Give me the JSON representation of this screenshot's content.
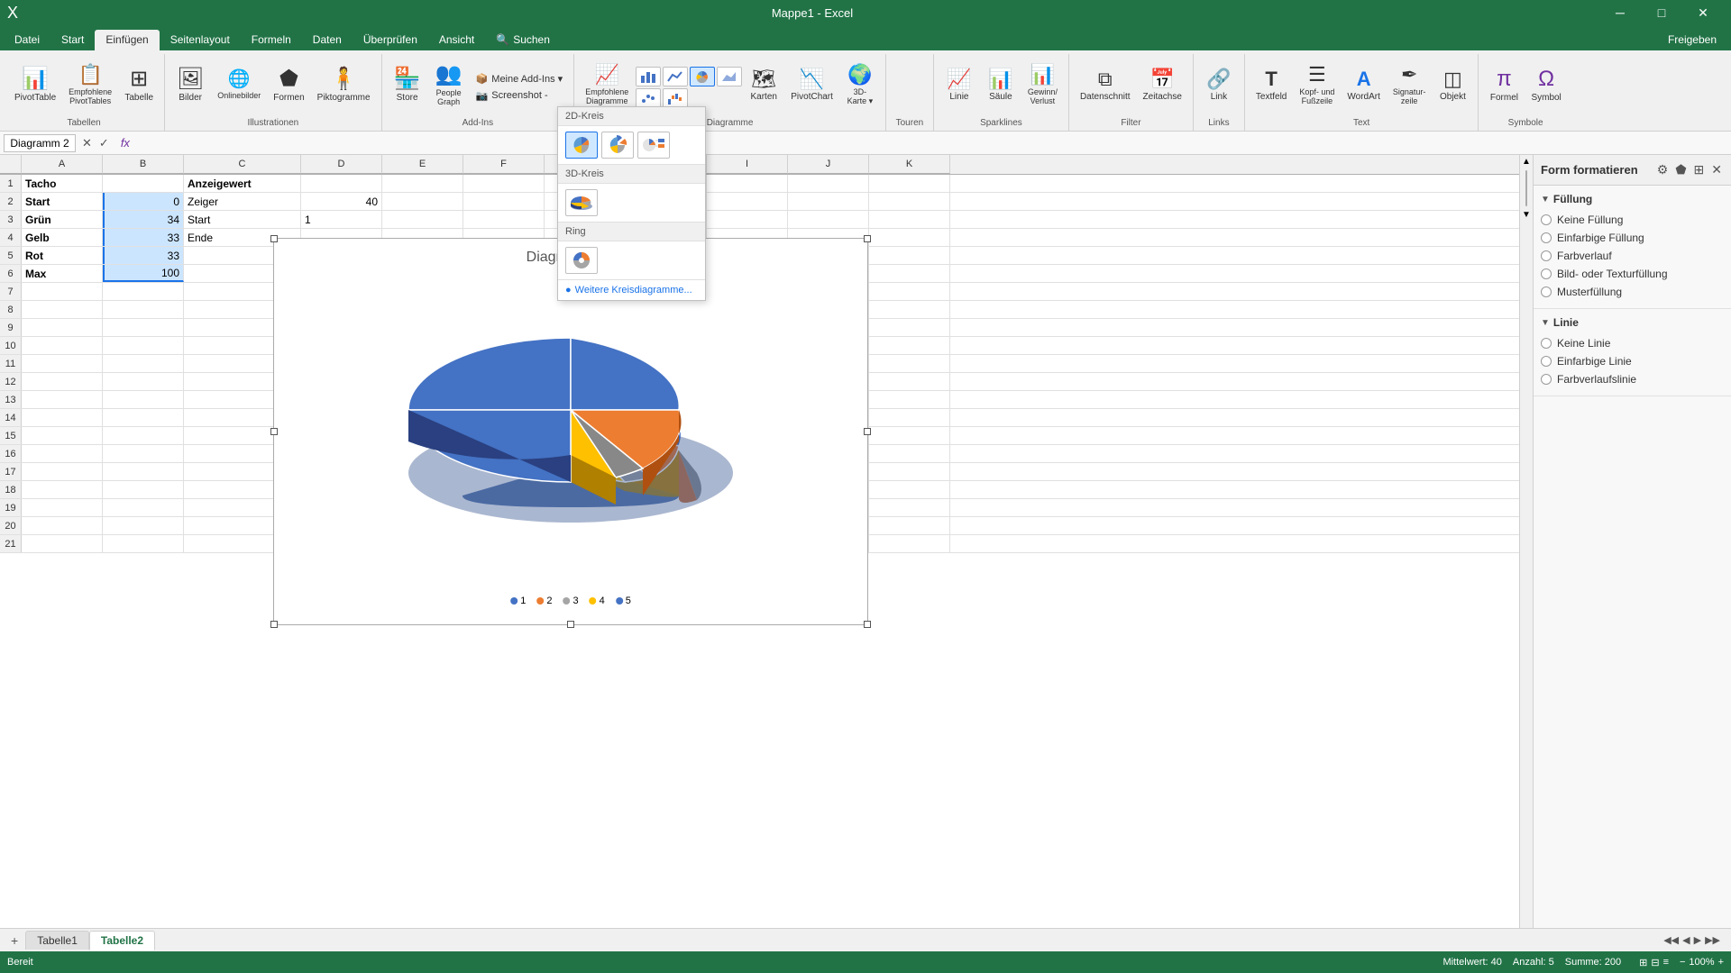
{
  "titleBar": {
    "title": "Mappe1 - Excel",
    "minBtn": "─",
    "maxBtn": "□",
    "closeBtn": "✕"
  },
  "ribbonTabs": [
    {
      "id": "datei",
      "label": "Datei"
    },
    {
      "id": "start",
      "label": "Start"
    },
    {
      "id": "einfugen",
      "label": "Einfügen",
      "active": true
    },
    {
      "id": "seitenlayout",
      "label": "Seitenlayout"
    },
    {
      "id": "formeln",
      "label": "Formeln"
    },
    {
      "id": "daten",
      "label": "Daten"
    },
    {
      "id": "uberprüfen",
      "label": "Überprüfen"
    },
    {
      "id": "ansicht",
      "label": "Ansicht"
    },
    {
      "id": "suchen",
      "label": "🔍 Suchen"
    }
  ],
  "ribbonGroups": [
    {
      "id": "tabellen",
      "label": "Tabellen",
      "buttons": [
        {
          "id": "pivottable",
          "icon": "📊",
          "label": "PivotTable"
        },
        {
          "id": "empfohlene-pivottables",
          "icon": "📋",
          "label": "Empfohlene\nPivotTables"
        },
        {
          "id": "tabelle",
          "icon": "⊞",
          "label": "Tabelle"
        }
      ]
    },
    {
      "id": "illustrationen",
      "label": "Illustrationen",
      "buttons": [
        {
          "id": "bilder",
          "icon": "🖼",
          "label": "Bilder"
        },
        {
          "id": "onlinebilder",
          "icon": "🌐",
          "label": "Onlinebilder"
        },
        {
          "id": "formen",
          "icon": "⬟",
          "label": "Formen"
        },
        {
          "id": "piktogramme",
          "icon": "🧍",
          "label": "Piktogramme"
        }
      ]
    },
    {
      "id": "add-ins",
      "label": "Add-Ins",
      "buttons": [
        {
          "id": "store",
          "icon": "🏪",
          "label": "Store"
        },
        {
          "id": "people-graph",
          "icon": "👥",
          "label": "People\nGraph"
        },
        {
          "id": "meine-add-ins",
          "icon": "📦",
          "label": "Meine Add-Ins ▾"
        },
        {
          "id": "screenshot",
          "icon": "📷",
          "label": "Screenshot -"
        }
      ]
    },
    {
      "id": "diagramme",
      "label": "Diagramme",
      "buttons": [
        {
          "id": "empfohlene-diagramme",
          "icon": "📈",
          "label": "Empfohlene\nDiagramme"
        },
        {
          "id": "diagramm-type",
          "icon": "⋯",
          "label": ""
        },
        {
          "id": "karten",
          "icon": "🗺",
          "label": "Karten"
        },
        {
          "id": "pivotchart",
          "icon": "📉",
          "label": "PivotChart"
        },
        {
          "id": "3d-karte",
          "icon": "🌍",
          "label": "3D-\nKarte ▾"
        }
      ]
    },
    {
      "id": "touren",
      "label": "Touren",
      "buttons": []
    },
    {
      "id": "sparklines",
      "label": "Sparklines",
      "buttons": [
        {
          "id": "linie",
          "icon": "📈",
          "label": "Linie"
        },
        {
          "id": "saule",
          "icon": "📊",
          "label": "Säule"
        },
        {
          "id": "gewinn-verlust",
          "icon": "📊",
          "label": "Gewinn/\nVerlust"
        }
      ]
    },
    {
      "id": "filter",
      "label": "Filter",
      "buttons": [
        {
          "id": "datenschnitt",
          "icon": "⧉",
          "label": "Datenschnitt"
        },
        {
          "id": "zeitachse",
          "icon": "📅",
          "label": "Zeitachse"
        }
      ]
    },
    {
      "id": "links",
      "label": "Links",
      "buttons": [
        {
          "id": "link",
          "icon": "🔗",
          "label": "Link"
        }
      ]
    },
    {
      "id": "text",
      "label": "Text",
      "buttons": [
        {
          "id": "textfeld",
          "icon": "T",
          "label": "Textfeld"
        },
        {
          "id": "kopf-fusszeile",
          "icon": "☰",
          "label": "Kopf- und\nFußzeile"
        },
        {
          "id": "wordart",
          "icon": "A",
          "label": "WordArt"
        },
        {
          "id": "signaturzeile",
          "icon": "✒",
          "label": "Signatur-\nzeile"
        },
        {
          "id": "objekt",
          "icon": "◫",
          "label": "Objekt"
        }
      ]
    },
    {
      "id": "symbole",
      "label": "Symbole",
      "buttons": [
        {
          "id": "formel",
          "icon": "π",
          "label": "Formel"
        },
        {
          "id": "symbol",
          "icon": "Ω",
          "label": "Symbol"
        }
      ]
    }
  ],
  "formulaBar": {
    "cellRef": "Diagramm 2",
    "formula": ""
  },
  "columns": [
    "A",
    "B",
    "C",
    "D",
    "E",
    "F",
    "G",
    "H",
    "I",
    "J",
    "K"
  ],
  "rows": [
    {
      "num": 1,
      "cells": [
        "Tacho",
        "",
        "Anzeigewert",
        "",
        "",
        "",
        "",
        "",
        "",
        "",
        ""
      ]
    },
    {
      "num": 2,
      "cells": [
        "Start",
        "0",
        "Zeiger",
        "40",
        "",
        "",
        "",
        "",
        "",
        "",
        ""
      ]
    },
    {
      "num": 3,
      "cells": [
        "Grün",
        "34",
        "Start",
        "1",
        "",
        "",
        "",
        "",
        "",
        "",
        ""
      ]
    },
    {
      "num": 4,
      "cells": [
        "Gelb",
        "33",
        "Ende",
        "",
        "",
        "",
        "",
        "",
        "",
        "",
        ""
      ]
    },
    {
      "num": 5,
      "cells": [
        "Rot",
        "33",
        "",
        "",
        "",
        "",
        "",
        "",
        "",
        "",
        ""
      ]
    },
    {
      "num": 6,
      "cells": [
        "Max",
        "100",
        "",
        "",
        "",
        "",
        "",
        "",
        "",
        "",
        ""
      ]
    },
    {
      "num": 7,
      "cells": [
        "",
        "",
        "",
        "",
        "",
        "",
        "",
        "",
        "",
        "",
        ""
      ]
    },
    {
      "num": 8,
      "cells": [
        "",
        "",
        "",
        "",
        "",
        "",
        "",
        "",
        "",
        "",
        ""
      ]
    },
    {
      "num": 9,
      "cells": [
        "",
        "",
        "",
        "",
        "",
        "",
        "",
        "",
        "",
        "",
        ""
      ]
    },
    {
      "num": 10,
      "cells": [
        "",
        "",
        "",
        "",
        "",
        "",
        "",
        "",
        "",
        "",
        ""
      ]
    },
    {
      "num": 11,
      "cells": [
        "",
        "",
        "",
        "",
        "",
        "",
        "",
        "",
        "",
        "",
        ""
      ]
    },
    {
      "num": 12,
      "cells": [
        "",
        "",
        "",
        "",
        "",
        "",
        "",
        "",
        "",
        "",
        ""
      ]
    },
    {
      "num": 13,
      "cells": [
        "",
        "",
        "",
        "",
        "",
        "",
        "",
        "",
        "",
        "",
        ""
      ]
    },
    {
      "num": 14,
      "cells": [
        "",
        "",
        "",
        "",
        "",
        "",
        "",
        "",
        "",
        "",
        ""
      ]
    },
    {
      "num": 15,
      "cells": [
        "",
        "",
        "",
        "",
        "",
        "",
        "",
        "",
        "",
        "",
        ""
      ]
    },
    {
      "num": 16,
      "cells": [
        "",
        "",
        "",
        "",
        "",
        "",
        "",
        "",
        "",
        "",
        ""
      ]
    },
    {
      "num": 17,
      "cells": [
        "",
        "",
        "",
        "",
        "",
        "",
        "",
        "",
        "",
        "",
        ""
      ]
    },
    {
      "num": 18,
      "cells": [
        "",
        "",
        "",
        "",
        "",
        "",
        "",
        "",
        "",
        "",
        ""
      ]
    },
    {
      "num": 19,
      "cells": [
        "",
        "",
        "",
        "",
        "",
        "",
        "",
        "",
        "",
        "",
        ""
      ]
    },
    {
      "num": 20,
      "cells": [
        "",
        "",
        "",
        "",
        "",
        "",
        "",
        "",
        "",
        "",
        ""
      ]
    },
    {
      "num": 21,
      "cells": [
        "",
        "",
        "",
        "",
        "",
        "",
        "",
        "",
        "",
        "",
        ""
      ]
    }
  ],
  "chartDropdown": {
    "section1": "2D-Kreis",
    "section2": "3D-Kreis",
    "section3": "Ring",
    "moreLabel": "Weitere Kreisdiagramme...",
    "icons2d": [
      "pie-full",
      "pie-exploded",
      "pie-bar"
    ],
    "icons3d": [
      "pie3d"
    ],
    "iconsRing": [
      "ring"
    ]
  },
  "chart": {
    "title": "Diagrammtitel",
    "legendItems": [
      {
        "label": "1",
        "color": "#4472C4"
      },
      {
        "label": "2",
        "color": "#ED7D31"
      },
      {
        "label": "3",
        "color": "#A5A5A5"
      },
      {
        "label": "4",
        "color": "#FFC000"
      },
      {
        "label": "5",
        "color": "#5B9BD5"
      }
    ],
    "data": [
      34,
      33,
      33,
      100,
      40
    ]
  },
  "rightPanel": {
    "title": "Form formatieren",
    "sections": {
      "fullung": {
        "title": "Füllung",
        "options": [
          "Keine Füllung",
          "Einfarbige Füllung",
          "Farbverlauf",
          "Bild- oder Texturfüllung",
          "Musterfüllung"
        ]
      },
      "linie": {
        "title": "Linie",
        "options": [
          "Keine Linie",
          "Einfarbige Linie",
          "Farbverlaufslinie"
        ]
      }
    }
  },
  "sheetTabs": [
    {
      "id": "tabelle1",
      "label": "Tabelle1"
    },
    {
      "id": "tabelle2",
      "label": "Tabelle2",
      "active": true
    }
  ],
  "statusBar": {
    "status": "Bereit",
    "mittelwert": "Mittelwert: 40",
    "anzahl": "Anzahl: 5",
    "summe": "Summe: 200"
  }
}
